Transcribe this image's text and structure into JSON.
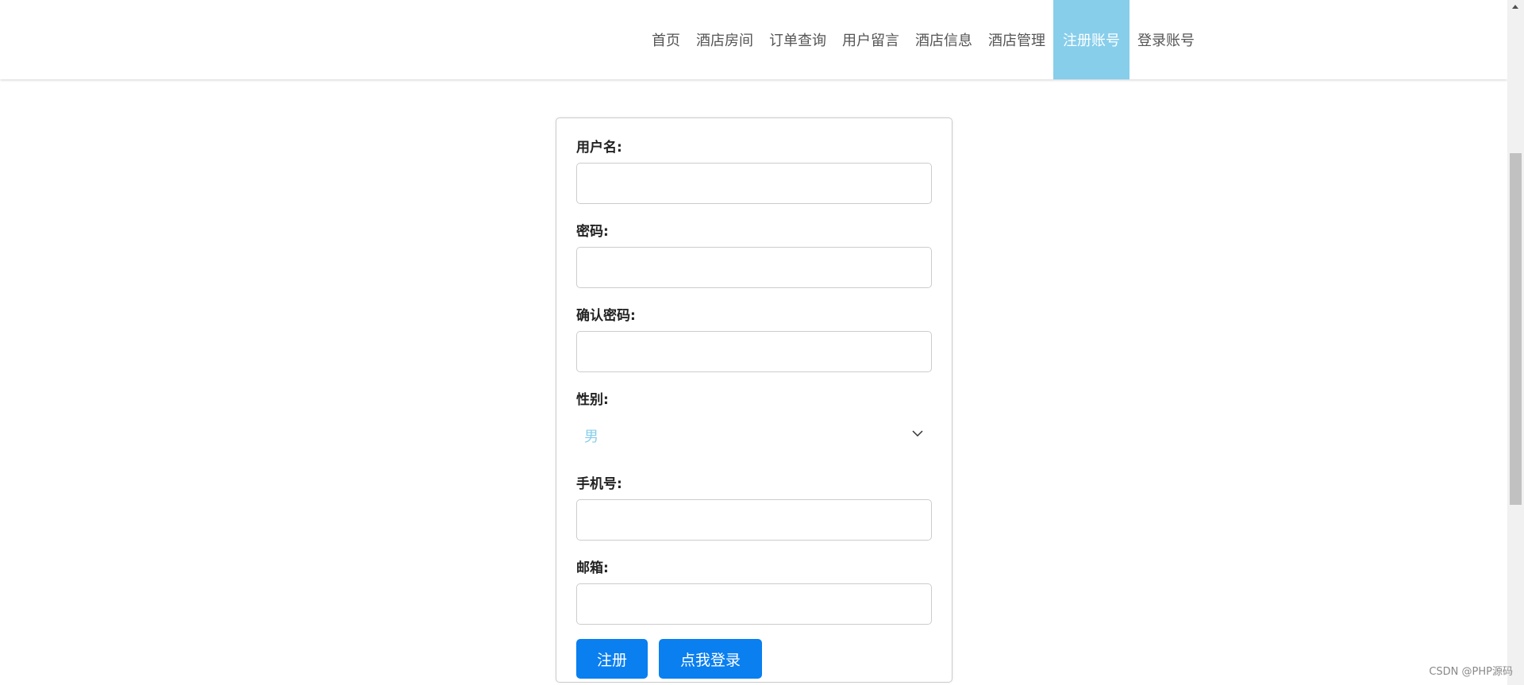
{
  "nav": {
    "items": [
      {
        "label": "首页"
      },
      {
        "label": "酒店房间"
      },
      {
        "label": "订单查询"
      },
      {
        "label": "用户留言"
      },
      {
        "label": "酒店信息"
      },
      {
        "label": "酒店管理"
      },
      {
        "label": "注册账号",
        "active": true
      },
      {
        "label": "登录账号"
      }
    ],
    "active_color": "#87CEEB"
  },
  "form": {
    "username_label": "用户名:",
    "username_value": "",
    "password_label": "密码:",
    "password_value": "",
    "confirm_label": "确认密码:",
    "confirm_value": "",
    "gender_label": "性别:",
    "gender_selected": "男",
    "phone_label": "手机号:",
    "phone_value": "",
    "email_label": "邮箱:",
    "email_value": "",
    "register_button": "注册",
    "login_button": "点我登录"
  },
  "colors": {
    "button": "#0a7ff0",
    "select_text": "#87CEEB"
  },
  "icons": {
    "select": "chevron-down-icon",
    "scroll": "scroll-up-arrow-icon"
  },
  "watermark": "CSDN @PHP源码"
}
